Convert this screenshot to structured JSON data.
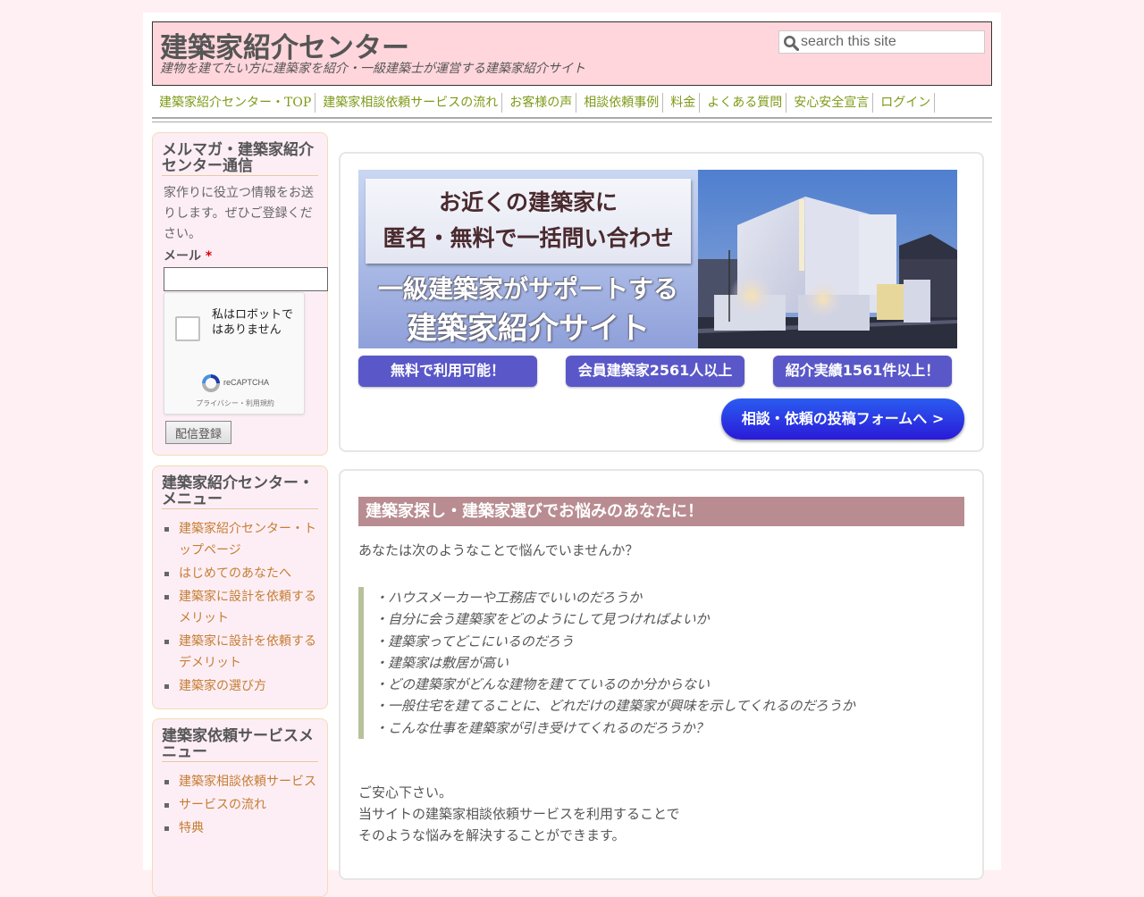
{
  "header": {
    "site_title": "建築家紹介センター",
    "tagline": "建物を建てたい方に建築家を紹介・一級建築士が運営する建築家紹介サイト",
    "search_placeholder": "search this site"
  },
  "nav": {
    "items": [
      {
        "label": "建築家紹介センター・TOP"
      },
      {
        "label": "建築家相談依頼サービスの流れ"
      },
      {
        "label": "お客様の声"
      },
      {
        "label": "相談依頼事例"
      },
      {
        "label": "料金"
      },
      {
        "label": "よくある質問"
      },
      {
        "label": "安心安全宣言"
      },
      {
        "label": "ログイン"
      }
    ]
  },
  "sidebar": {
    "newsletter": {
      "title": "メルマガ・建築家紹介センター通信",
      "description": "家作りに役立つ情報をお送りします。ぜひご登録ください。",
      "email_label": "メール",
      "required_mark": "*",
      "email_value": "",
      "recaptcha_label": "私はロボットではありません",
      "recaptcha_brand": "reCAPTCHA",
      "recaptcha_terms": "プライバシー・利用規約",
      "subscribe_label": "配信登録"
    },
    "center_menu": {
      "title": "建築家紹介センター・メニュー",
      "items": [
        {
          "label": "建築家紹介センター・トップページ"
        },
        {
          "label": "はじめてのあなたへ"
        },
        {
          "label": "建築家に設計を依頼するメリット"
        },
        {
          "label": "建築家に設計を依頼するデメリット"
        },
        {
          "label": "建築家の選び方"
        }
      ]
    },
    "service_menu": {
      "title": "建築家依頼サービスメニュー",
      "items": [
        {
          "label": "建築家相談依頼サービス"
        },
        {
          "label": "サービスの流れ"
        },
        {
          "label": "特典"
        }
      ]
    }
  },
  "hero": {
    "banner_line1": "お近くの建築家に",
    "banner_line2": "匿名・無料で一括問い合わせ",
    "banner_line3": "一級建築家がサポートする",
    "banner_line4": "建築家紹介サイト",
    "badges": [
      {
        "label": "無料で利用可能！"
      },
      {
        "label": "会員建築家2561人以上"
      },
      {
        "label": "紹介実績1561件以上！"
      }
    ],
    "cta_label": "相談・依頼の投稿フォームへ >"
  },
  "content": {
    "heading": "建築家探し・建築家選びでお悩みのあなたに！",
    "intro": "あなたは次のようなことで悩んでいませんか？",
    "worries": [
      "・ハウスメーカーや工務店でいいのだろうか",
      "・自分に会う建築家をどのようにして見つければよいか",
      "・建築家ってどこにいるのだろう",
      "・建築家は敷居が高い",
      "・どの建築家がどんな建物を建てているのか分からない",
      "・一般住宅を建てることに、どれだけの建築家が興味を示してくれるのだろうか",
      "・こんな仕事を建築家が引き受けてくれるのだろうか？"
    ],
    "closing": [
      "ご安心下さい。",
      "当サイトの建築家相談依頼サービスを利用することで",
      "そのような悩みを解決することができます。"
    ]
  },
  "colors": {
    "page_bg": "#fff0f3",
    "header_bg": "#ffd6dc",
    "nav_link": "#7d9a17",
    "sidebar_link": "#c57e32",
    "sidebar_bg": "#fdeef6",
    "heading_bg": "#b88c91",
    "badge_bg": "#5a58c8",
    "quote_border": "#b7c29a"
  }
}
